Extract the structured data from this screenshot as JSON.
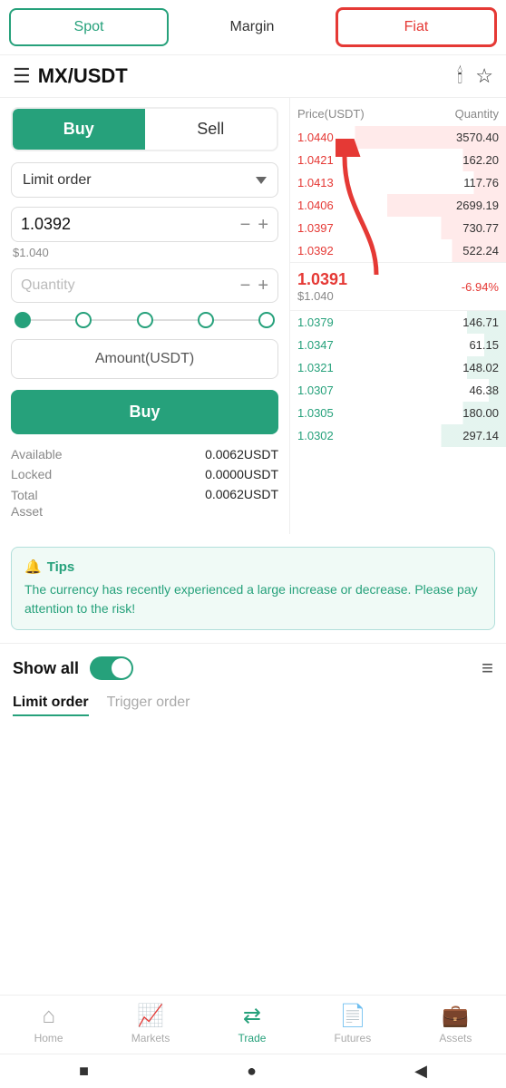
{
  "tabs": {
    "spot": "Spot",
    "margin": "Margin",
    "fiat": "Fiat"
  },
  "header": {
    "title": "MX/USDT"
  },
  "trading": {
    "buy_label": "Buy",
    "sell_label": "Sell",
    "order_type": "Limit order",
    "price_value": "1.0392",
    "price_hint": "$1.040",
    "quantity_placeholder": "Quantity",
    "amount_label": "Amount(USDT)",
    "buy_action": "Buy",
    "available_label": "Available",
    "available_value": "0.0062USDT",
    "locked_label": "Locked",
    "locked_value": "0.0000USDT",
    "total_asset_label": "Total\nAsset",
    "total_asset_value": "0.0062USDT"
  },
  "orderbook": {
    "header_price": "Price(USDT)",
    "header_qty": "Quantity",
    "asks": [
      {
        "price": "1.0440",
        "qty": "3570.40",
        "fill": "70%"
      },
      {
        "price": "1.0421",
        "qty": "162.20",
        "fill": "20%"
      },
      {
        "price": "1.0413",
        "qty": "117.76",
        "fill": "15%"
      },
      {
        "price": "1.0406",
        "qty": "2699.19",
        "fill": "55%"
      },
      {
        "price": "1.0397",
        "qty": "730.77",
        "fill": "30%"
      },
      {
        "price": "1.0392",
        "qty": "522.24",
        "fill": "25%"
      }
    ],
    "current_price": "1.0391",
    "current_usd": "$1.040",
    "current_change": "-6.94%",
    "bids": [
      {
        "price": "1.0379",
        "qty": "146.71",
        "fill": "18%"
      },
      {
        "price": "1.0347",
        "qty": "61.15",
        "fill": "10%"
      },
      {
        "price": "1.0321",
        "qty": "148.02",
        "fill": "18%"
      },
      {
        "price": "1.0307",
        "qty": "46.38",
        "fill": "8%"
      },
      {
        "price": "1.0305",
        "qty": "180.00",
        "fill": "20%"
      },
      {
        "price": "1.0302",
        "qty": "297.14",
        "fill": "30%"
      }
    ]
  },
  "tips": {
    "icon": "🔔",
    "title": "Tips",
    "text": "The currency has recently experienced a large increase or decrease. Please pay attention to the risk!"
  },
  "show_all": {
    "label": "Show all",
    "list_icon": "≡"
  },
  "order_tabs": {
    "limit": "Limit order",
    "trigger": "Trigger order"
  },
  "bottom_nav": [
    {
      "icon": "🏠",
      "label": "Home",
      "active": false
    },
    {
      "icon": "📈",
      "label": "Markets",
      "active": false
    },
    {
      "icon": "💱",
      "label": "Trade",
      "active": true
    },
    {
      "icon": "📄",
      "label": "Futures",
      "active": false
    },
    {
      "icon": "💼",
      "label": "Assets",
      "active": false
    }
  ],
  "android_nav": {
    "square": "■",
    "circle": "●",
    "triangle": "◀"
  }
}
